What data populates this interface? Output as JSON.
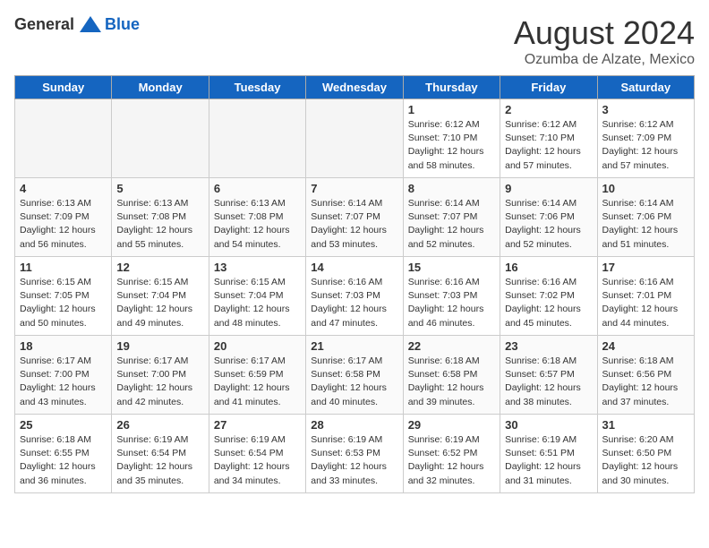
{
  "logo": {
    "general": "General",
    "blue": "Blue"
  },
  "title": "August 2024",
  "location": "Ozumba de Alzate, Mexico",
  "days_of_week": [
    "Sunday",
    "Monday",
    "Tuesday",
    "Wednesday",
    "Thursday",
    "Friday",
    "Saturday"
  ],
  "weeks": [
    [
      {
        "day": "",
        "empty": true
      },
      {
        "day": "",
        "empty": true
      },
      {
        "day": "",
        "empty": true
      },
      {
        "day": "",
        "empty": true
      },
      {
        "day": "1",
        "sunrise": "6:12 AM",
        "sunset": "7:10 PM",
        "daylight": "12 hours and 58 minutes."
      },
      {
        "day": "2",
        "sunrise": "6:12 AM",
        "sunset": "7:10 PM",
        "daylight": "12 hours and 57 minutes."
      },
      {
        "day": "3",
        "sunrise": "6:12 AM",
        "sunset": "7:09 PM",
        "daylight": "12 hours and 57 minutes."
      }
    ],
    [
      {
        "day": "4",
        "sunrise": "6:13 AM",
        "sunset": "7:09 PM",
        "daylight": "12 hours and 56 minutes."
      },
      {
        "day": "5",
        "sunrise": "6:13 AM",
        "sunset": "7:08 PM",
        "daylight": "12 hours and 55 minutes."
      },
      {
        "day": "6",
        "sunrise": "6:13 AM",
        "sunset": "7:08 PM",
        "daylight": "12 hours and 54 minutes."
      },
      {
        "day": "7",
        "sunrise": "6:14 AM",
        "sunset": "7:07 PM",
        "daylight": "12 hours and 53 minutes."
      },
      {
        "day": "8",
        "sunrise": "6:14 AM",
        "sunset": "7:07 PM",
        "daylight": "12 hours and 52 minutes."
      },
      {
        "day": "9",
        "sunrise": "6:14 AM",
        "sunset": "7:06 PM",
        "daylight": "12 hours and 52 minutes."
      },
      {
        "day": "10",
        "sunrise": "6:14 AM",
        "sunset": "7:06 PM",
        "daylight": "12 hours and 51 minutes."
      }
    ],
    [
      {
        "day": "11",
        "sunrise": "6:15 AM",
        "sunset": "7:05 PM",
        "daylight": "12 hours and 50 minutes."
      },
      {
        "day": "12",
        "sunrise": "6:15 AM",
        "sunset": "7:04 PM",
        "daylight": "12 hours and 49 minutes."
      },
      {
        "day": "13",
        "sunrise": "6:15 AM",
        "sunset": "7:04 PM",
        "daylight": "12 hours and 48 minutes."
      },
      {
        "day": "14",
        "sunrise": "6:16 AM",
        "sunset": "7:03 PM",
        "daylight": "12 hours and 47 minutes."
      },
      {
        "day": "15",
        "sunrise": "6:16 AM",
        "sunset": "7:03 PM",
        "daylight": "12 hours and 46 minutes."
      },
      {
        "day": "16",
        "sunrise": "6:16 AM",
        "sunset": "7:02 PM",
        "daylight": "12 hours and 45 minutes."
      },
      {
        "day": "17",
        "sunrise": "6:16 AM",
        "sunset": "7:01 PM",
        "daylight": "12 hours and 44 minutes."
      }
    ],
    [
      {
        "day": "18",
        "sunrise": "6:17 AM",
        "sunset": "7:00 PM",
        "daylight": "12 hours and 43 minutes."
      },
      {
        "day": "19",
        "sunrise": "6:17 AM",
        "sunset": "7:00 PM",
        "daylight": "12 hours and 42 minutes."
      },
      {
        "day": "20",
        "sunrise": "6:17 AM",
        "sunset": "6:59 PM",
        "daylight": "12 hours and 41 minutes."
      },
      {
        "day": "21",
        "sunrise": "6:17 AM",
        "sunset": "6:58 PM",
        "daylight": "12 hours and 40 minutes."
      },
      {
        "day": "22",
        "sunrise": "6:18 AM",
        "sunset": "6:58 PM",
        "daylight": "12 hours and 39 minutes."
      },
      {
        "day": "23",
        "sunrise": "6:18 AM",
        "sunset": "6:57 PM",
        "daylight": "12 hours and 38 minutes."
      },
      {
        "day": "24",
        "sunrise": "6:18 AM",
        "sunset": "6:56 PM",
        "daylight": "12 hours and 37 minutes."
      }
    ],
    [
      {
        "day": "25",
        "sunrise": "6:18 AM",
        "sunset": "6:55 PM",
        "daylight": "12 hours and 36 minutes."
      },
      {
        "day": "26",
        "sunrise": "6:19 AM",
        "sunset": "6:54 PM",
        "daylight": "12 hours and 35 minutes."
      },
      {
        "day": "27",
        "sunrise": "6:19 AM",
        "sunset": "6:54 PM",
        "daylight": "12 hours and 34 minutes."
      },
      {
        "day": "28",
        "sunrise": "6:19 AM",
        "sunset": "6:53 PM",
        "daylight": "12 hours and 33 minutes."
      },
      {
        "day": "29",
        "sunrise": "6:19 AM",
        "sunset": "6:52 PM",
        "daylight": "12 hours and 32 minutes."
      },
      {
        "day": "30",
        "sunrise": "6:19 AM",
        "sunset": "6:51 PM",
        "daylight": "12 hours and 31 minutes."
      },
      {
        "day": "31",
        "sunrise": "6:20 AM",
        "sunset": "6:50 PM",
        "daylight": "12 hours and 30 minutes."
      }
    ]
  ]
}
